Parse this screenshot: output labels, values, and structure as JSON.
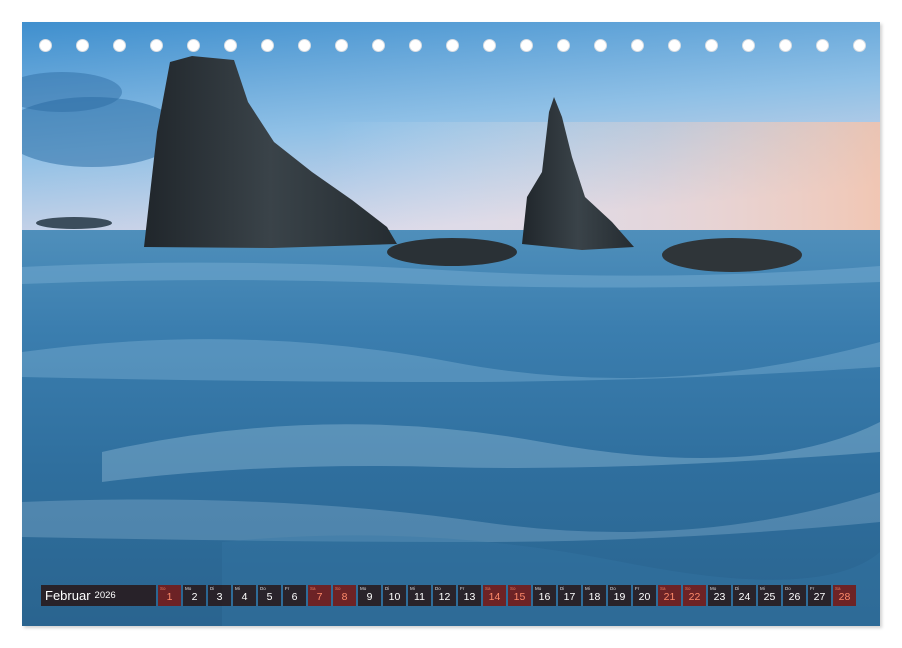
{
  "calendar": {
    "month": "Februar",
    "year": "2026",
    "days": [
      {
        "wd": "So",
        "d": "1",
        "weekend": true
      },
      {
        "wd": "Mo",
        "d": "2",
        "weekend": false
      },
      {
        "wd": "Di",
        "d": "3",
        "weekend": false
      },
      {
        "wd": "Mi",
        "d": "4",
        "weekend": false
      },
      {
        "wd": "Do",
        "d": "5",
        "weekend": false
      },
      {
        "wd": "Fr",
        "d": "6",
        "weekend": false
      },
      {
        "wd": "Sa",
        "d": "7",
        "weekend": true
      },
      {
        "wd": "So",
        "d": "8",
        "weekend": true
      },
      {
        "wd": "Mo",
        "d": "9",
        "weekend": false
      },
      {
        "wd": "Di",
        "d": "10",
        "weekend": false
      },
      {
        "wd": "Mi",
        "d": "11",
        "weekend": false
      },
      {
        "wd": "Do",
        "d": "12",
        "weekend": false
      },
      {
        "wd": "Fr",
        "d": "13",
        "weekend": false
      },
      {
        "wd": "Sa",
        "d": "14",
        "weekend": true
      },
      {
        "wd": "So",
        "d": "15",
        "weekend": true
      },
      {
        "wd": "Mo",
        "d": "16",
        "weekend": false
      },
      {
        "wd": "Di",
        "d": "17",
        "weekend": false
      },
      {
        "wd": "Mi",
        "d": "18",
        "weekend": false
      },
      {
        "wd": "Do",
        "d": "19",
        "weekend": false
      },
      {
        "wd": "Fr",
        "d": "20",
        "weekend": false
      },
      {
        "wd": "Sa",
        "d": "21",
        "weekend": true
      },
      {
        "wd": "So",
        "d": "22",
        "weekend": true
      },
      {
        "wd": "Mo",
        "d": "23",
        "weekend": false
      },
      {
        "wd": "Di",
        "d": "24",
        "weekend": false
      },
      {
        "wd": "Mi",
        "d": "25",
        "weekend": false
      },
      {
        "wd": "Do",
        "d": "26",
        "weekend": false
      },
      {
        "wd": "Fr",
        "d": "27",
        "weekend": false
      },
      {
        "wd": "Sa",
        "d": "28",
        "weekend": true
      }
    ]
  },
  "colors": {
    "sky_top": "#4a9ad2",
    "sky_horizon": "#f2c8b5",
    "sea": "#2b6e9c",
    "rock": "#2c3338",
    "weekend_text": "#ff8a6a"
  }
}
